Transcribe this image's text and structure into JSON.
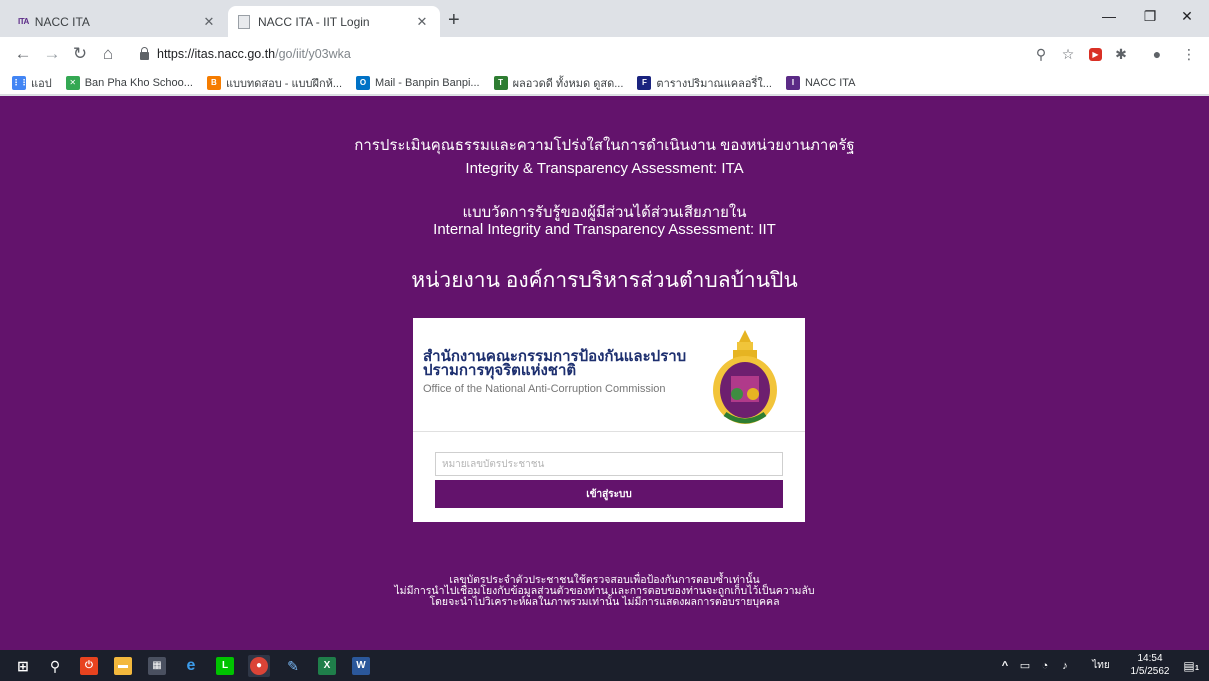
{
  "browser": {
    "tabs": [
      {
        "favicon": "ITA",
        "title": "NACC ITA"
      },
      {
        "favicon": "doc-icon",
        "title": "NACC ITA - IIT Login"
      }
    ],
    "url_host": "https://itas.nacc.go.th",
    "url_path": "/go/iit/y03wka",
    "bookmarks": [
      {
        "label": "แอป",
        "icon": "apps-grid-icon",
        "color": "#4285f4"
      },
      {
        "label": "Ban Pha Kho Schoo...",
        "icon": "maps-icon",
        "color": "#34a853"
      },
      {
        "label": "แบบทดสอบ - แบบฝึกห้...",
        "icon": "blogger-icon",
        "color": "#f57c00"
      },
      {
        "label": "Mail - Banpin Banpi...",
        "icon": "outlook-icon",
        "color": "#0072c6"
      },
      {
        "label": "ผลอวดดี ทั้งหมด ดูสด...",
        "icon": "tv-icon",
        "color": "#2e7d32"
      },
      {
        "label": "ตารางปริมาณแคลอรี่ใ...",
        "icon": "fn-icon",
        "color": "#1a237e"
      },
      {
        "label": "NACC ITA",
        "icon": "ita-icon",
        "color": "#5b2a86"
      }
    ]
  },
  "page": {
    "line1": "การประเมินคุณธรรมและความโปร่งใสในการดำเนินงาน ของหน่วยงานภาครัฐ",
    "line2": "Integrity & Transparency Assessment: ITA",
    "line3": "แบบวัดการรับรู้ของผู้มีส่วนได้ส่วนเสียภายใน",
    "line4": "Internal Integrity and Transparency Assessment: IIT",
    "agency": "หน่วยงาน องค์การบริหารส่วนตำบลบ้านปิน",
    "org_th": "สำนักงานคณะกรรมการป้องกันและปราบปรามการทุจริตแห่งชาติ",
    "org_en": "Office of the National Anti-Corruption Commission",
    "id_placeholder": "หมายเลขบัตรประชาชน",
    "login_label": "เข้าสู่ระบบ",
    "note1": "เลขบัตรประจำตัวประชาชนใช้ตรวจสอบเพื่อป้องกันการตอบซ้ำเท่านั้น",
    "note2": "ไม่มีการนำไปเชื่อมโยงกับข้อมูลส่วนตัวของท่าน และการตอบของท่านจะถูกเก็บไว้เป็นความลับ",
    "note3": "โดยจะนำไปวิเคราะห์ผลในภาพรวมเท่านั้น ไม่มีการแสดงผลการตอบรายบุคคล"
  },
  "taskbar": {
    "lang": "ไทย",
    "time": "14:54",
    "date": "1/5/2562",
    "notif_count": "1"
  },
  "colors": {
    "page_bg": "#63136c",
    "button": "#63136c"
  }
}
